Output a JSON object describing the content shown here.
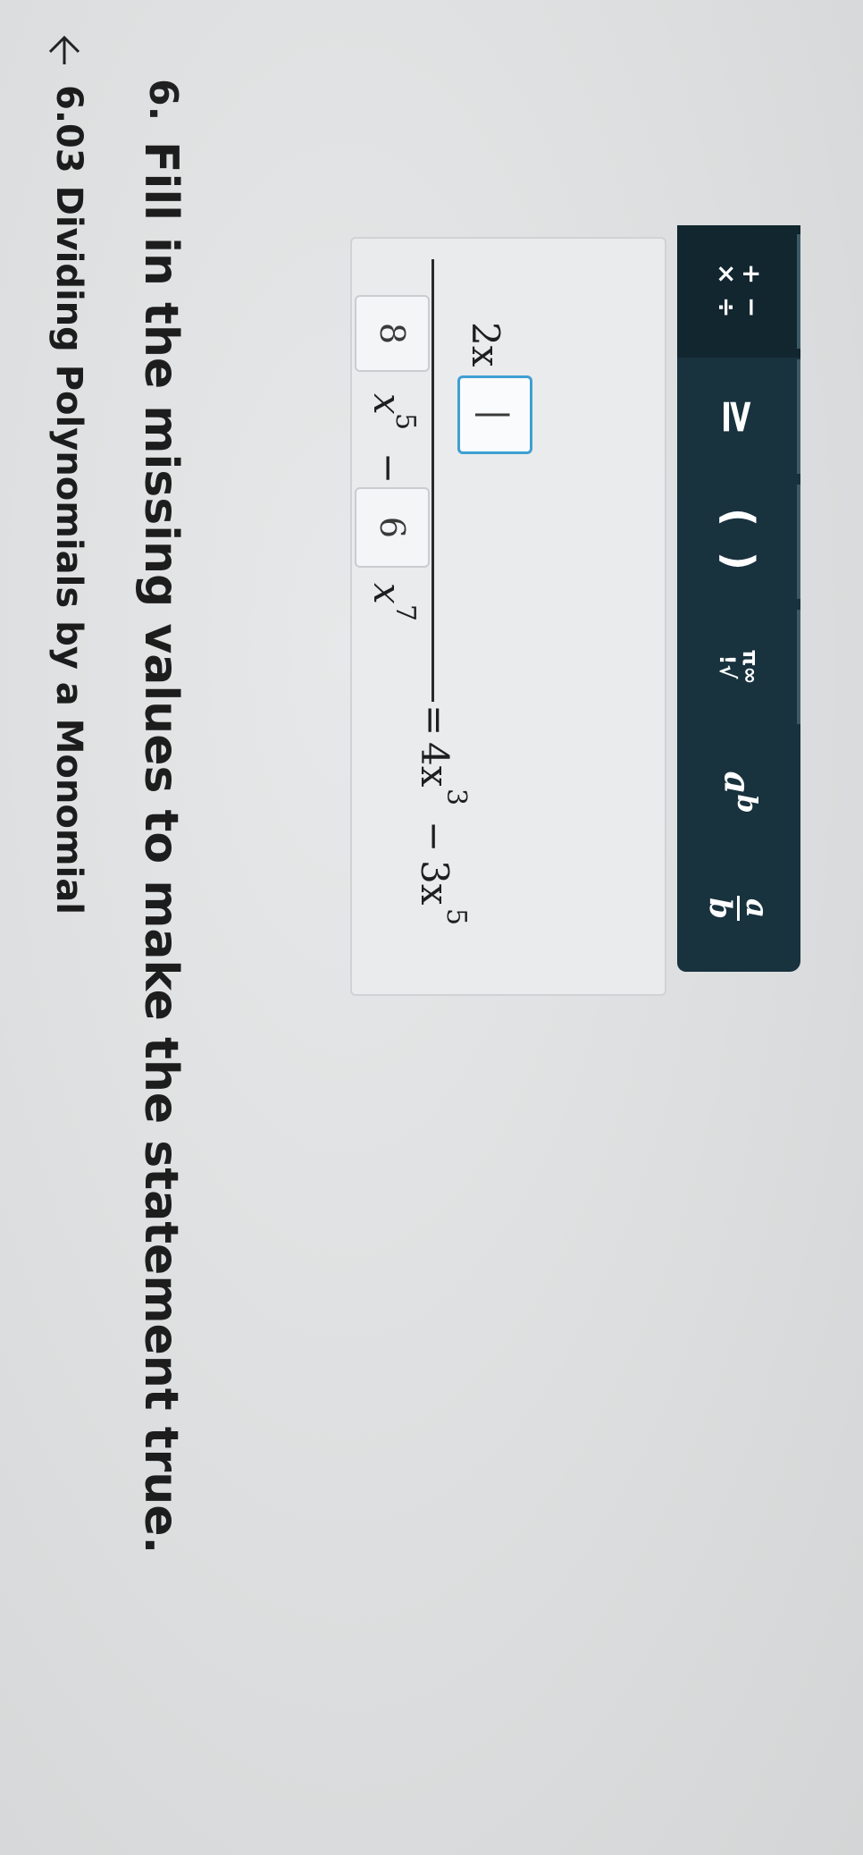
{
  "header": {
    "title": "6.03 Dividing Polynomials by a Monomial"
  },
  "question": {
    "number": "6.",
    "prompt": "Fill in the missing values to make the statement true."
  },
  "toolbar": {
    "tabs": [
      {
        "label": "+ − × ÷",
        "top": "+ −",
        "bottom": "× ÷"
      },
      {
        "label": "≥"
      },
      {
        "label": "( )"
      },
      {
        "label": "π ∞ ! √",
        "top": "π∞",
        "bottom": "!√"
      },
      {
        "label": "a^b",
        "base": "a",
        "exp": "b"
      },
      {
        "label": "a/b",
        "num": "a",
        "den": "b"
      }
    ]
  },
  "equation": {
    "numerator": {
      "coef1": "8",
      "var1": "x",
      "exp1": "5",
      "minus": "−",
      "coef2": "6",
      "var2": "x",
      "exp2": "7"
    },
    "denominator": {
      "coef": "2x",
      "exp_input": "|"
    },
    "equals": "=",
    "rhs": {
      "term1_coef": "4x",
      "term1_exp": "3",
      "minus": "−",
      "term2_coef": "3x",
      "term2_exp": "5"
    }
  },
  "colors": {
    "toolbar_bg": "#18323e",
    "active_input_border": "#3f9fd2"
  }
}
